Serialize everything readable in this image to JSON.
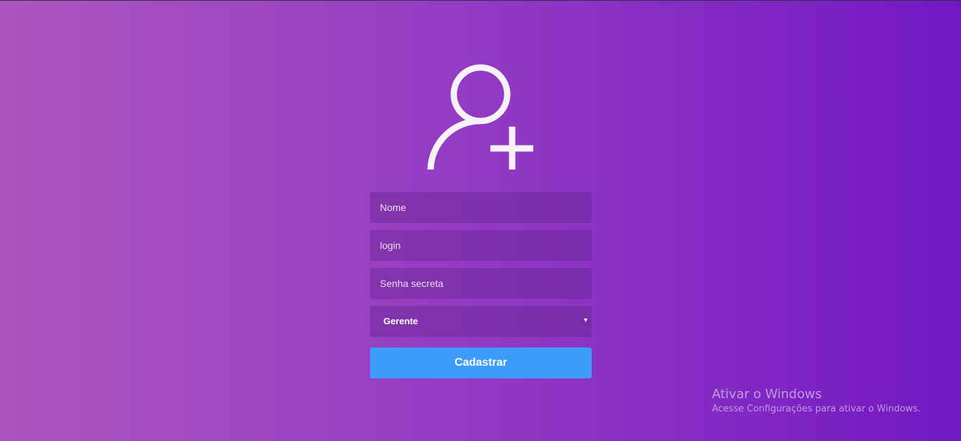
{
  "header": {
    "icon": "add-user-icon"
  },
  "form": {
    "name_placeholder": "Nome",
    "login_placeholder": "login",
    "password_placeholder": "Senha secreta",
    "role_select": {
      "selected": "Gerente",
      "arrow": "▾"
    },
    "submit_label": "Cadastrar"
  },
  "watermark": {
    "title": "Ativar o Windows",
    "subtitle": "Acesse Configurações para ativar o Windows."
  },
  "colors": {
    "background_start": "#ab56be",
    "background_end": "#7218c3",
    "button": "#3d9bfa",
    "icon": "#ffffff"
  }
}
